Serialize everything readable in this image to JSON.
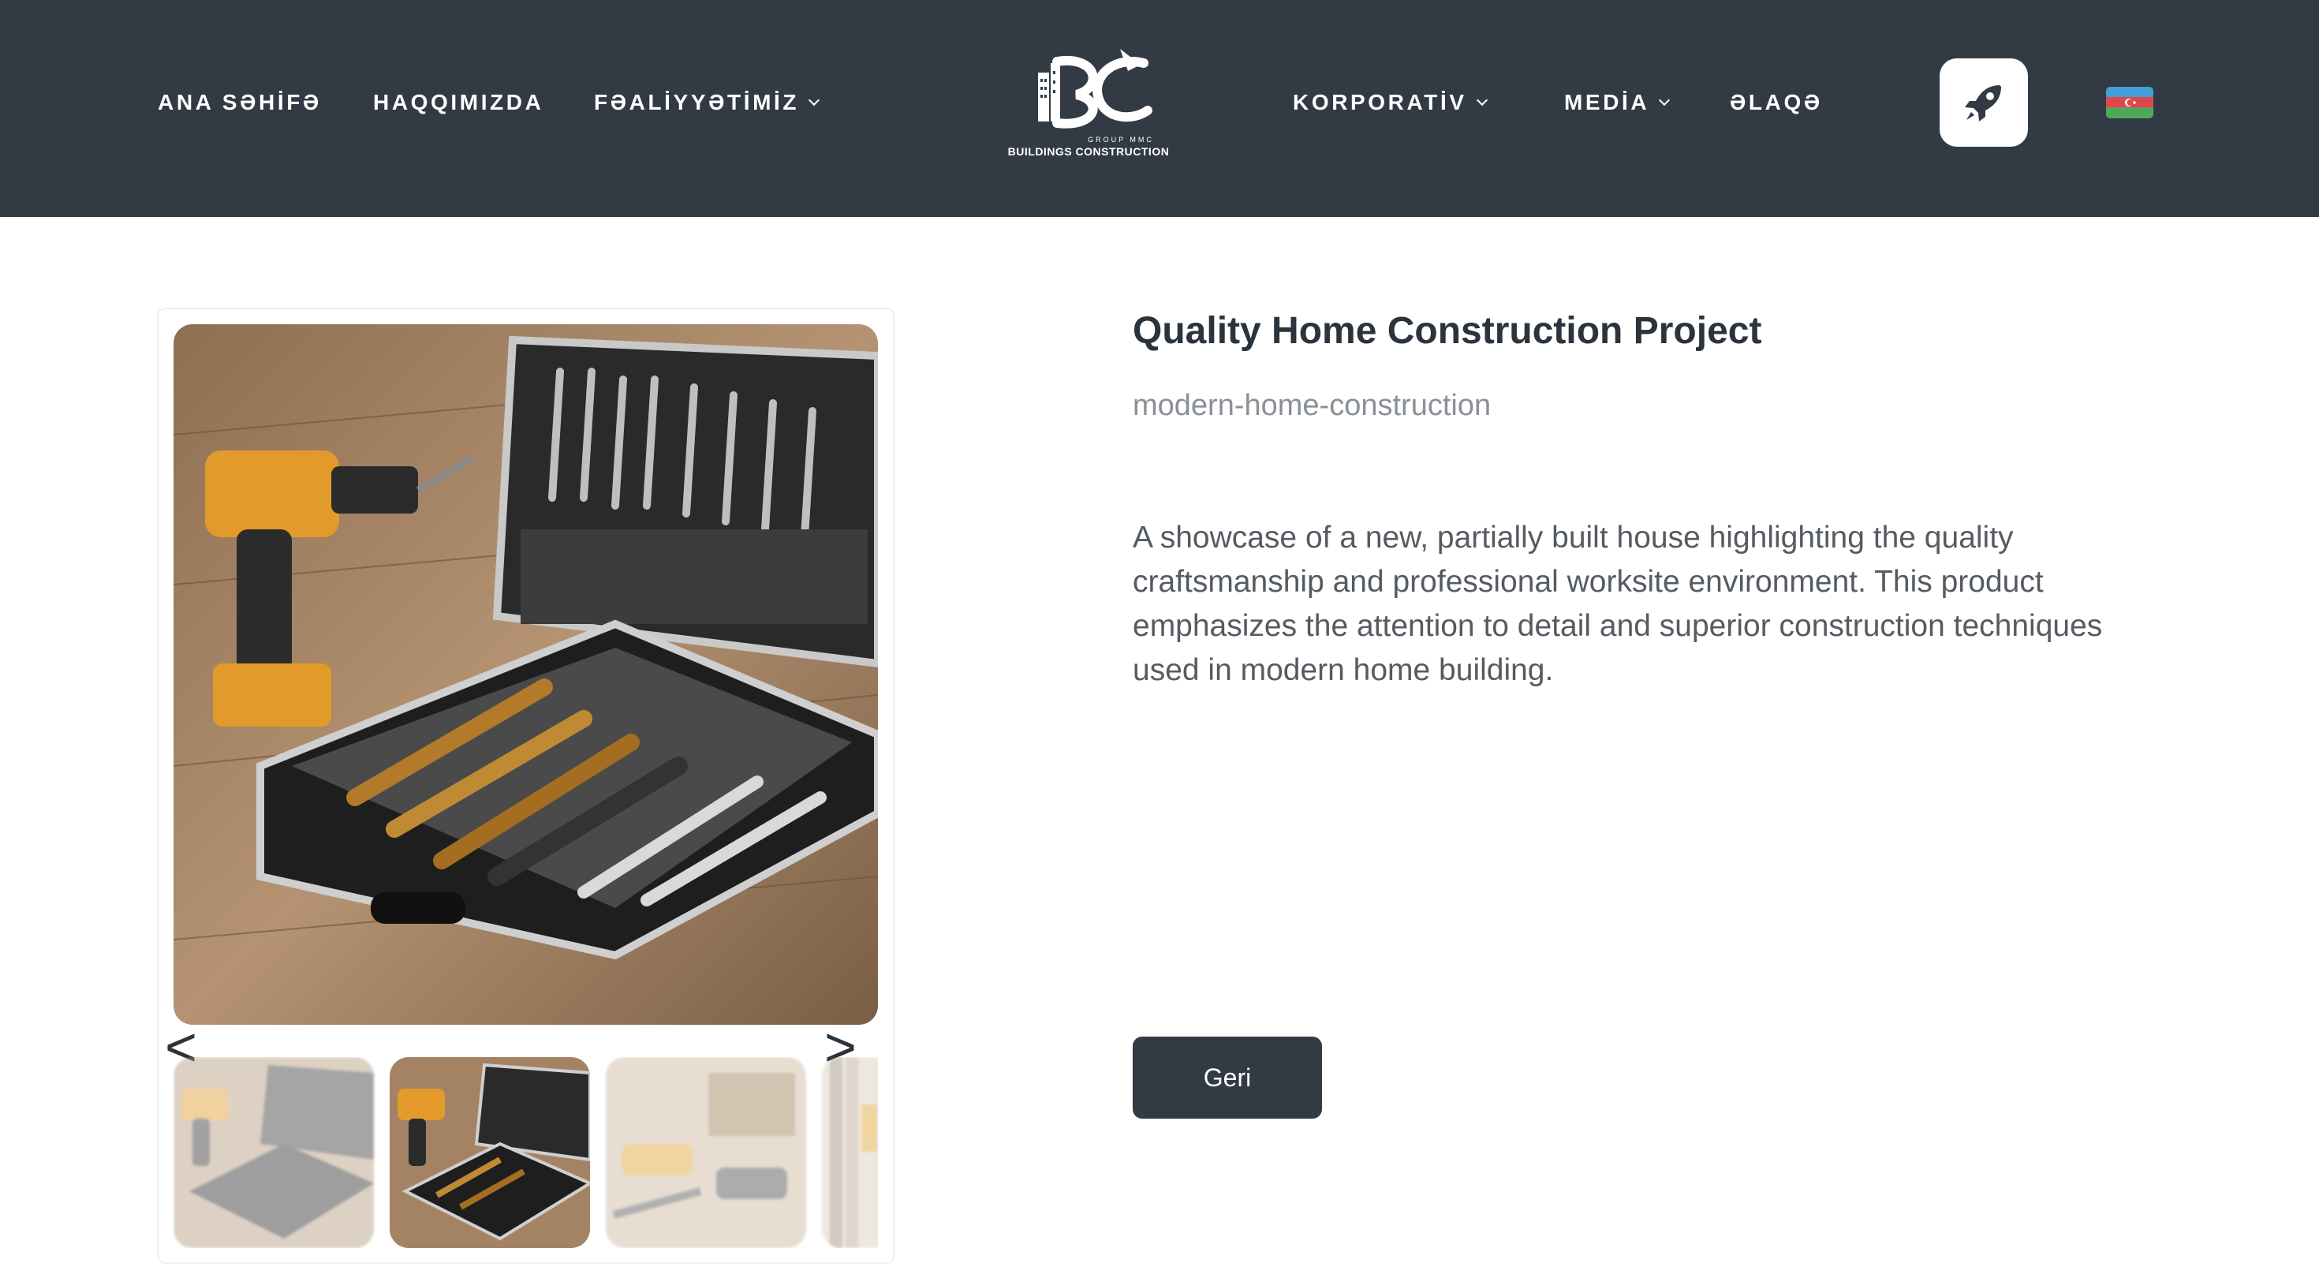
{
  "nav": {
    "home": "ANA SƏHİFƏ",
    "about": "HAQQIMIZDA",
    "activities": "FƏALİYYƏTİMİZ",
    "corporate": "KORPORATİV",
    "media": "MEDİA",
    "contact": "ƏLAQƏ"
  },
  "logo": {
    "main_text": "BUILDINGS CONSTRUCTION",
    "sub_text": "GROUP MMC"
  },
  "icons": {
    "rocket": "rocket-icon",
    "flag": "azerbaijan-flag-icon",
    "prev": "chevron-left-icon",
    "next": "chevron-right-icon"
  },
  "colors": {
    "header_bg": "#323a44",
    "button_bg": "#323a44",
    "flag_blue": "#3f9fd6",
    "flag_red": "#e2464d",
    "flag_green": "#4fa85a"
  },
  "gallery": {
    "prev_label": "<",
    "next_label": ">"
  },
  "product": {
    "title": "Quality Home Construction Project",
    "slug": "modern-home-construction",
    "description": " A showcase of a new, partially built house highlighting the quality craftsmanship and professional worksite environment. This product emphasizes the attention to detail and superior construction techniques used in modern home building.",
    "back_label": "Geri"
  }
}
